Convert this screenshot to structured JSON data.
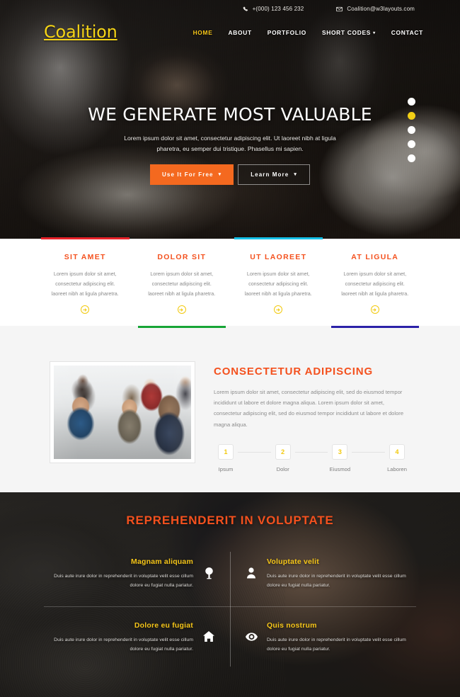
{
  "topbar": {
    "phone": "+(000) 123 456 232",
    "email": "Coalition@w3layouts.com",
    "phone_icon": "phone-icon",
    "email_icon": "envelope-icon"
  },
  "brand": {
    "logo": "Coalition",
    "logo_color": "#f5d416"
  },
  "nav": {
    "items": [
      {
        "label": "HOME",
        "active": true
      },
      {
        "label": "ABOUT",
        "active": false
      },
      {
        "label": "PORTFOLIO",
        "active": false
      },
      {
        "label": "SHORT CODES",
        "active": false,
        "caret": "▾"
      },
      {
        "label": "CONTACT",
        "active": false
      }
    ]
  },
  "hero": {
    "title": "WE GENERATE MOST VALUABLE",
    "subtitle": "Lorem ipsum dolor sit amet, consectetur adipiscing elit. Ut laoreet nibh at ligula pharetra, eu semper dui tristique. Phasellus mi sapien.",
    "primary_button": "Use It For Free",
    "secondary_button": "Learn More",
    "button_caret": "▾",
    "primary_color": "#f4691f",
    "slider_dots": 5,
    "slider_active_index": 1,
    "slider_active_color": "#f2cf15"
  },
  "services": {
    "items": [
      {
        "title": "SIT AMET",
        "text": "Lorem ipsum dolor sit amet, consectetur adipiscing elit. laoreet nibh at ligula pharetra.",
        "bar_color": "#e8232a",
        "bar_position": "top",
        "arrow_icon": "arrow-right-circle-icon"
      },
      {
        "title": "DOLOR SIT",
        "text": "Lorem ipsum dolor sit amet, consectetur adipiscing elit. laoreet nibh at ligula pharetra.",
        "bar_color": "#16a536",
        "bar_position": "bottom",
        "arrow_icon": "arrow-right-circle-icon"
      },
      {
        "title": "UT LAOREET",
        "text": "Lorem ipsum dolor sit amet, consectetur adipiscing elit. laoreet nibh at ligula pharetra.",
        "bar_color": "#15c1e8",
        "bar_position": "top",
        "arrow_icon": "arrow-right-circle-icon"
      },
      {
        "title": "AT LIGULA",
        "text": "Lorem ipsum dolor sit amet, consectetur adipiscing elit. laoreet nibh at ligula pharetra.",
        "bar_color": "#2b21a8",
        "bar_position": "bottom",
        "arrow_icon": "arrow-right-circle-icon"
      }
    ],
    "title_color": "#f4511e"
  },
  "about": {
    "image_alt": "business-team-meeting-photo",
    "title": "CONSECTETUR ADIPISCING",
    "text": "Lorem ipsum dolor sit amet, consectetur adipiscing elit, sed do eiusmod tempor incididunt ut labore et dolore magna aliqua. Lorem ipsum dolor sit amet, consectetur adipiscing elit, sed do eiusmod tempor incididunt ut labore et dolore magna aliqua.",
    "steps": [
      {
        "number": "1",
        "label": "Ipsum"
      },
      {
        "number": "2",
        "label": "Dolor"
      },
      {
        "number": "3",
        "label": "Eiusmod"
      },
      {
        "number": "4",
        "label": "Laboren"
      }
    ],
    "step_number_color": "#f2c90d"
  },
  "features": {
    "title": "REPREHENDERIT IN VOLUPTATE",
    "title_color": "#f4511e",
    "heading_color": "#f5c518",
    "items": [
      {
        "heading": "Magnam aliquam",
        "text": "Duis aute irure dolor in reprehenderit in voluptate velit esse cillum dolore eu fugiat nulla pariatur.",
        "icon": "tree-icon",
        "side": "left"
      },
      {
        "heading": "Voluptate velit",
        "text": "Duis aute irure dolor in reprehenderit in voluptate velit esse cillum dolore eu fugiat nulla pariatur.",
        "icon": "user-icon",
        "side": "right"
      },
      {
        "heading": "Dolore eu fugiat",
        "text": "Duis aute irure dolor in reprehenderit in voluptate velit esse cillum dolore eu fugiat nulla pariatur.",
        "icon": "home-icon",
        "side": "left"
      },
      {
        "heading": "Quis nostrum",
        "text": "Duis aute irure dolor in reprehenderit in voluptate velit esse cillum dolore eu fugiat nulla pariatur.",
        "icon": "eye-icon",
        "side": "right"
      }
    ]
  }
}
